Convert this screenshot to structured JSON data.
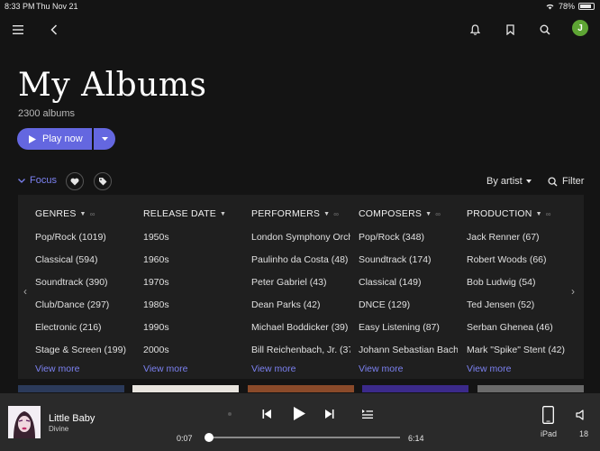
{
  "status": {
    "time": "8:33 PM",
    "date": "Thu Nov 21",
    "battery": "78%",
    "battery_level": 0.78
  },
  "user": {
    "initial": "J",
    "avatar_color": "#5ea534"
  },
  "page": {
    "title": "My Albums",
    "subtitle": "2300 albums"
  },
  "actions": {
    "play_label": "Play now",
    "accent": "#6467e0"
  },
  "filters": {
    "focus_label": "Focus",
    "sort_label": "By artist",
    "filter_label": "Filter"
  },
  "columns": [
    {
      "header": "GENRES",
      "items": [
        "Pop/Rock (1019)",
        "Classical (594)",
        "Soundtrack (390)",
        "Club/Dance (297)",
        "Electronic (216)",
        "Stage & Screen (199)"
      ],
      "more": "View more"
    },
    {
      "header": "RELEASE DATE",
      "items": [
        "1950s",
        "1960s",
        "1970s",
        "1980s",
        "1990s",
        "2000s"
      ],
      "more": "View more"
    },
    {
      "header": "PERFORMERS",
      "items": [
        "London Symphony Orch",
        "Paulinho da Costa (48)",
        "Peter Gabriel (43)",
        "Dean Parks (42)",
        "Michael Boddicker (39)",
        "Bill Reichenbach, Jr. (37"
      ],
      "more": "View more"
    },
    {
      "header": "COMPOSERS",
      "items": [
        "Pop/Rock (348)",
        "Soundtrack (174)",
        "Classical (149)",
        "DNCE (129)",
        "Easy Listening (87)",
        "Johann Sebastian Bach"
      ],
      "more": "View more"
    },
    {
      "header": "PRODUCTION",
      "items": [
        "Jack Renner (67)",
        "Robert Woods (66)",
        "Bob Ludwig (54)",
        "Ted Jensen (52)",
        "Serban Ghenea (46)",
        "Mark \"Spike\" Stent (42)"
      ],
      "more": "View more"
    }
  ],
  "player": {
    "track": "Little Baby",
    "artist": "Divine",
    "elapsed": "0:07",
    "duration": "6:14",
    "progress": 0.019,
    "device_label": "iPad",
    "volume_label": "18"
  },
  "icons": [
    "menu-icon",
    "back-icon",
    "bell-icon",
    "bookmark-icon",
    "search-icon",
    "heart-icon",
    "tag-icon",
    "filter-search-icon",
    "play-icon",
    "previous-icon",
    "next-icon",
    "queue-icon",
    "tablet-icon",
    "speaker-icon",
    "wifi-icon"
  ]
}
